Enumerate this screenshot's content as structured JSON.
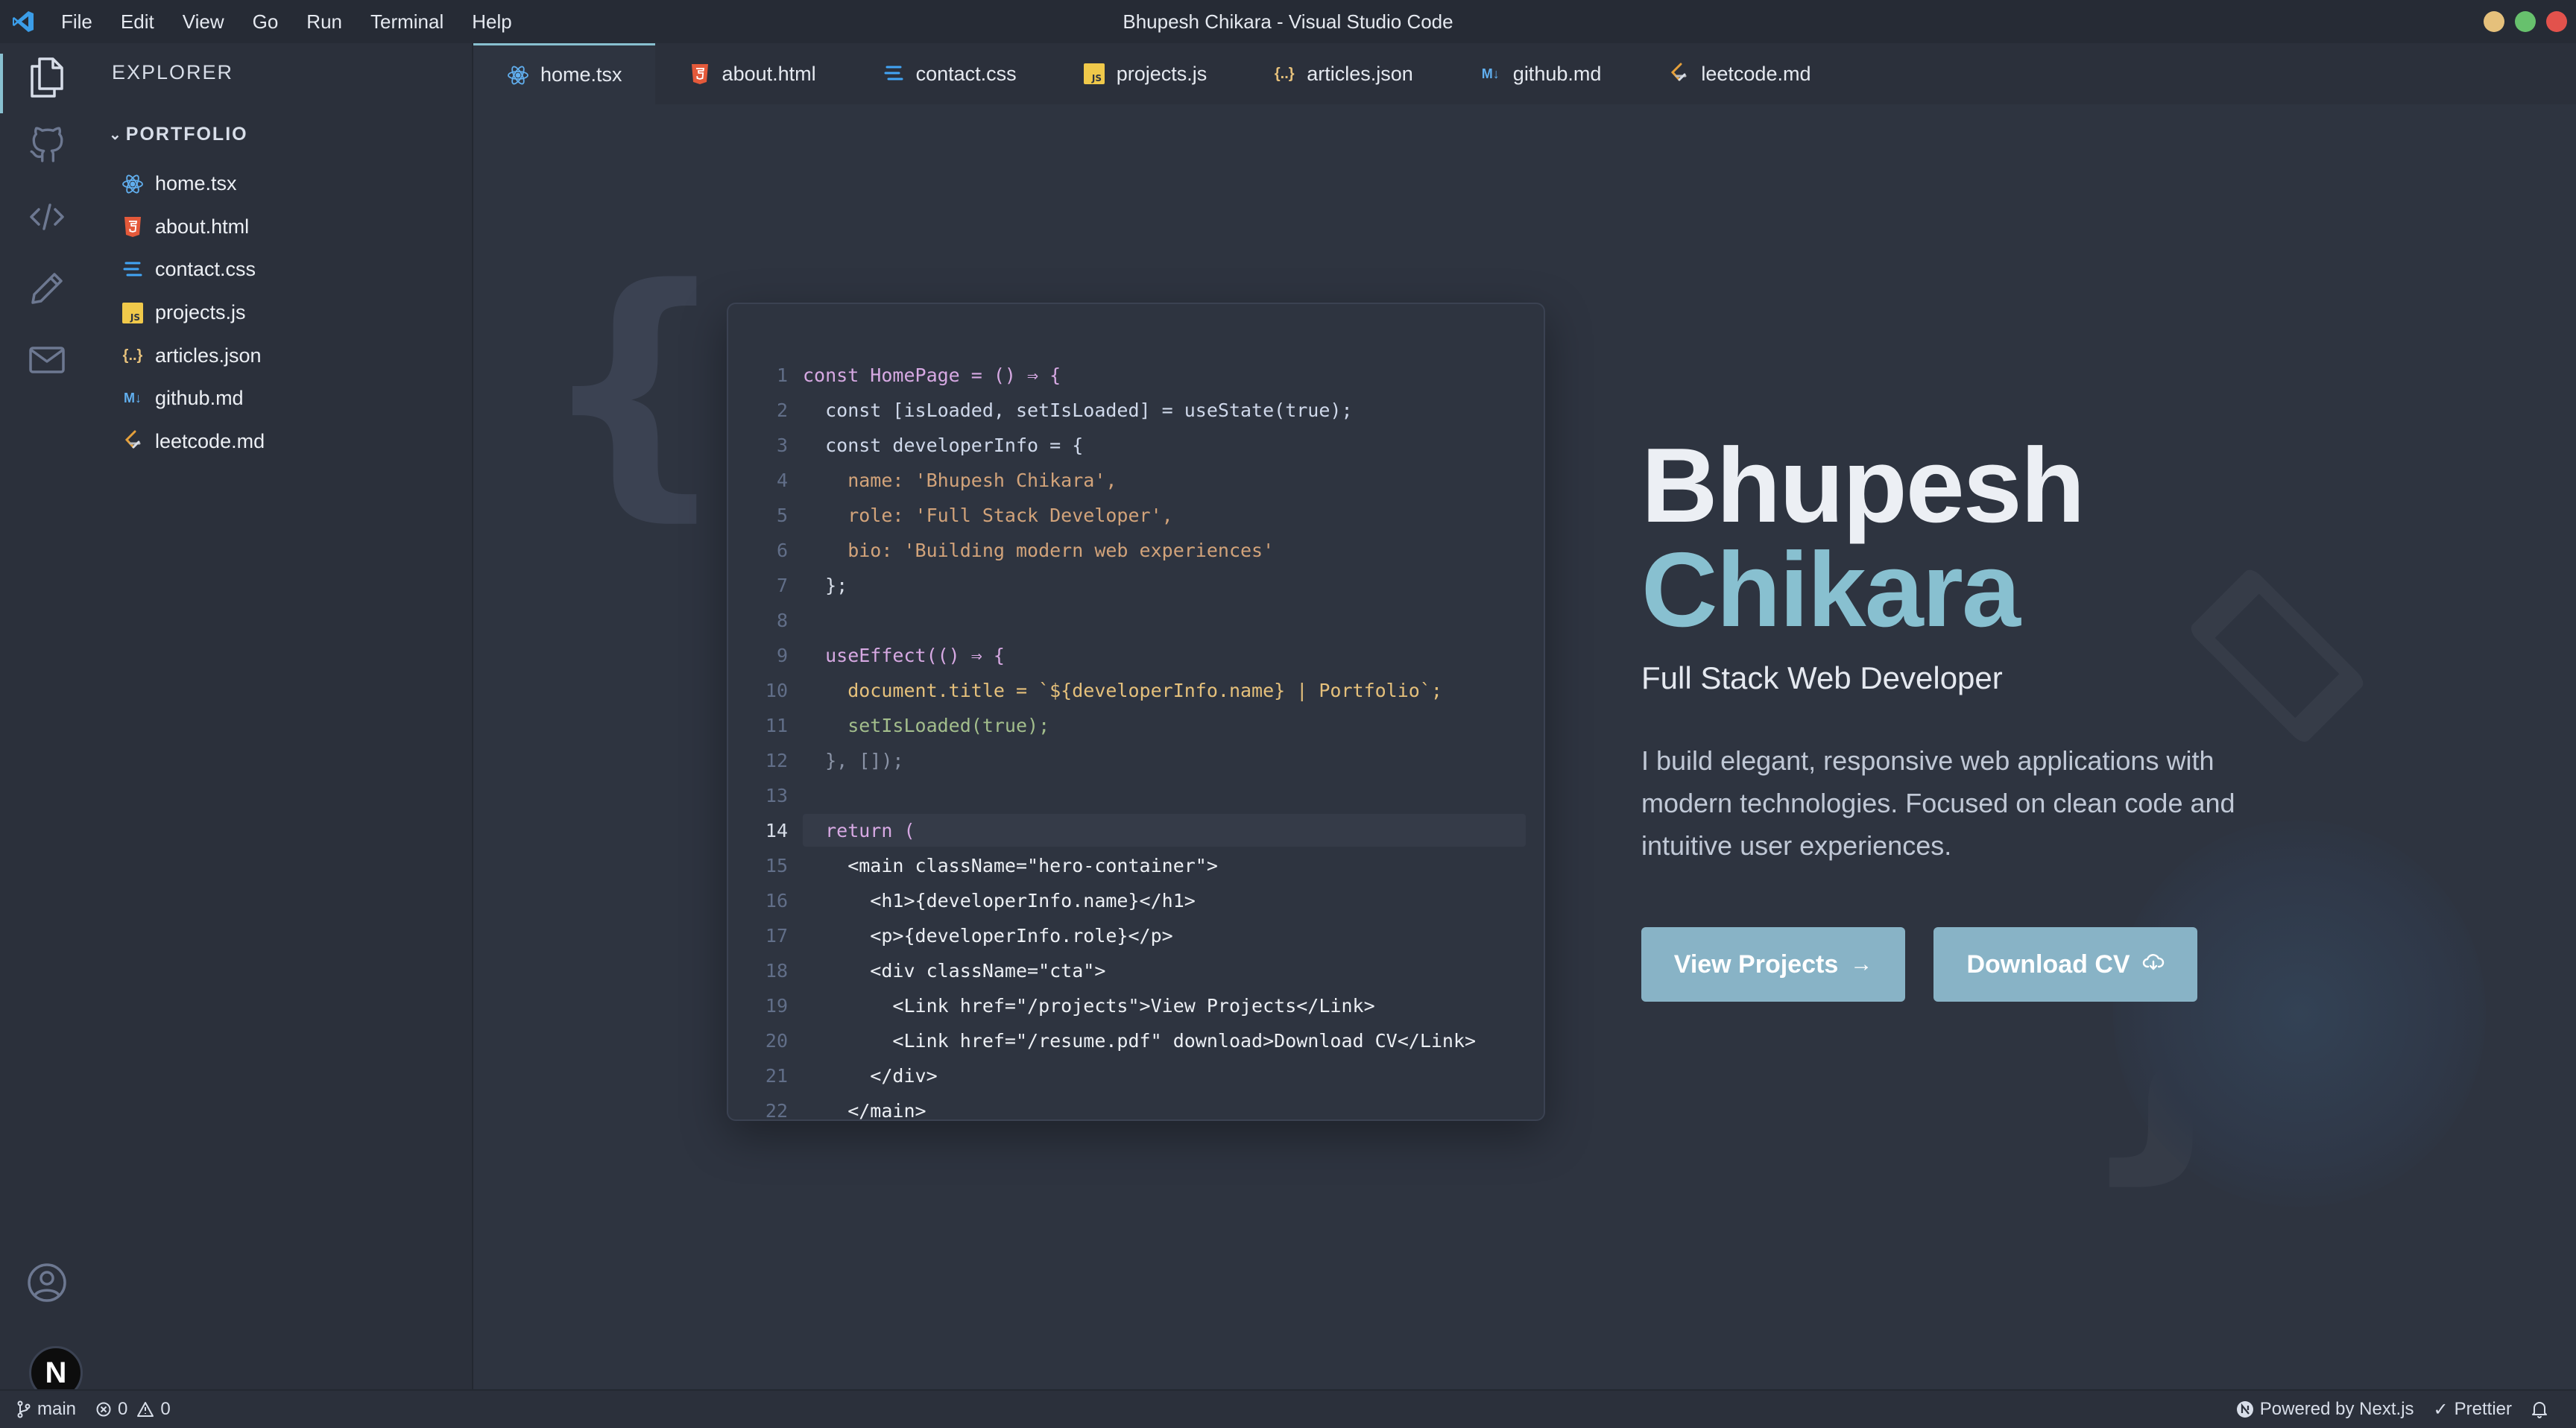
{
  "window": {
    "title": "Bhupesh Chikara - Visual Studio Code"
  },
  "menu": [
    "File",
    "Edit",
    "View",
    "Go",
    "Run",
    "Terminal",
    "Help"
  ],
  "activity_bar": {
    "items": [
      "explorer-icon",
      "github-icon",
      "code-icon",
      "pencil-icon",
      "mail-icon"
    ],
    "bottom": [
      "account-icon",
      "nextjs-badge"
    ],
    "badge_letter": "N"
  },
  "sidebar": {
    "title": "EXPLORER",
    "folder": "PORTFOLIO",
    "files": [
      {
        "name": "home.tsx",
        "icon": "react-icon"
      },
      {
        "name": "about.html",
        "icon": "html-icon"
      },
      {
        "name": "contact.css",
        "icon": "css-icon"
      },
      {
        "name": "projects.js",
        "icon": "js-icon"
      },
      {
        "name": "articles.json",
        "icon": "json-icon"
      },
      {
        "name": "github.md",
        "icon": "markdown-icon"
      },
      {
        "name": "leetcode.md",
        "icon": "leetcode-icon"
      }
    ]
  },
  "tabs": [
    {
      "label": "home.tsx",
      "active": true
    },
    {
      "label": "about.html"
    },
    {
      "label": "contact.css"
    },
    {
      "label": "projects.js"
    },
    {
      "label": "articles.json"
    },
    {
      "label": "github.md"
    },
    {
      "label": "leetcode.md"
    }
  ],
  "code": {
    "current_line": 14,
    "lines": [
      {
        "n": "1",
        "text": "const HomePage = () ⇒ {"
      },
      {
        "n": "2",
        "text": "  const [isLoaded, setIsLoaded] = useState(true);"
      },
      {
        "n": "3",
        "text": "  const developerInfo = {"
      },
      {
        "n": "4",
        "text": "    name: 'Bhupesh Chikara',"
      },
      {
        "n": "5",
        "text": "    role: 'Full Stack Developer',"
      },
      {
        "n": "6",
        "text": "    bio: 'Building modern web experiences'"
      },
      {
        "n": "7",
        "text": "  };"
      },
      {
        "n": "8",
        "text": ""
      },
      {
        "n": "9",
        "text": "  useEffect(() ⇒ {"
      },
      {
        "n": "10",
        "text": "    document.title = `${developerInfo.name} | Portfolio`;"
      },
      {
        "n": "11",
        "text": "    setIsLoaded(true);"
      },
      {
        "n": "12",
        "text": "  }, []);"
      },
      {
        "n": "13",
        "text": ""
      },
      {
        "n": "14",
        "text": "  return ("
      },
      {
        "n": "15",
        "text": "    <main className=\"hero-container\">"
      },
      {
        "n": "16",
        "text": "      <h1>{developerInfo.name}</h1>"
      },
      {
        "n": "17",
        "text": "      <p>{developerInfo.role}</p>"
      },
      {
        "n": "18",
        "text": "      <div className=\"cta\">"
      },
      {
        "n": "19",
        "text": "        <Link href=\"/projects\">View Projects</Link>"
      },
      {
        "n": "20",
        "text": "        <Link href=\"/resume.pdf\" download>Download CV</Link>"
      },
      {
        "n": "21",
        "text": "      </div>"
      },
      {
        "n": "22",
        "text": "    </main>"
      }
    ]
  },
  "hero": {
    "first_name": "Bhupesh",
    "last_name": "Chikara",
    "role": "Full Stack Web Developer",
    "bio": "I build elegant, responsive web applications with modern technologies. Focused on clean code and intuitive user experiences.",
    "primary_button": "View Projects",
    "secondary_button": "Download CV"
  },
  "status_bar": {
    "branch": "main",
    "errors": "0",
    "warnings": "0",
    "powered_by": "Powered by Next.js",
    "formatter": "Prettier"
  },
  "colors": {
    "accent": "#88c0d0",
    "button": "#88b3c6",
    "background": "#2e3440",
    "sidebar": "#2b303b",
    "titlebar": "#262b35",
    "close": "#e2524c",
    "minimize": "#e5c07b",
    "maximize": "#67c16d"
  }
}
